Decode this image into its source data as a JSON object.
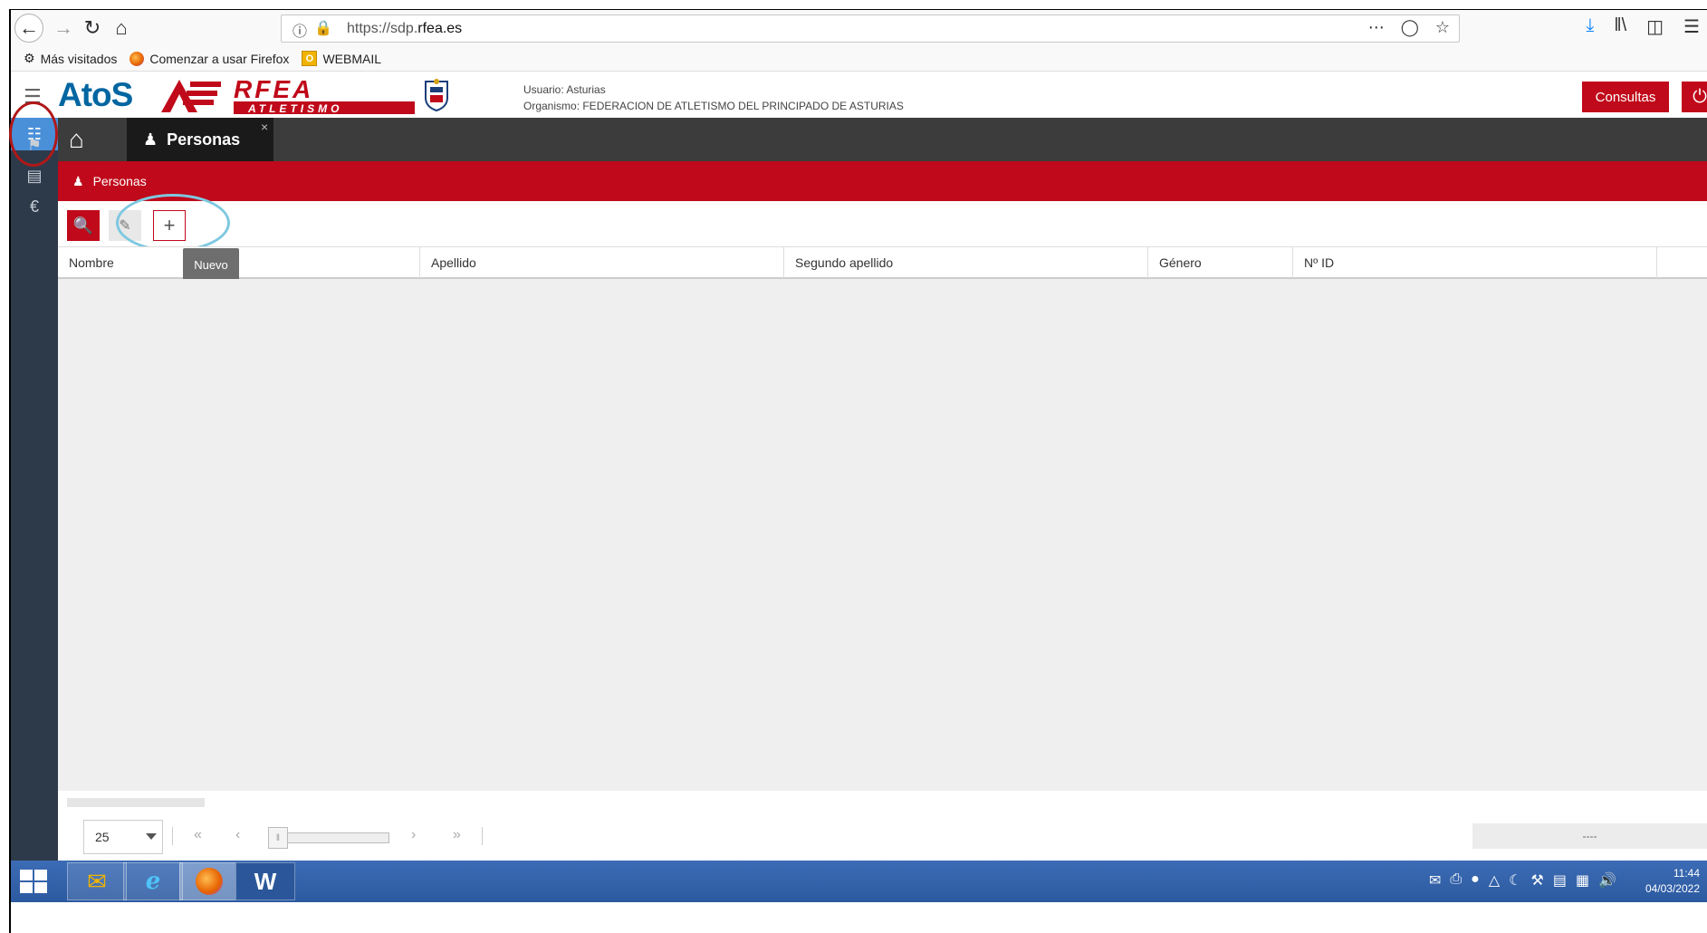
{
  "browser": {
    "url_prefix": "https://sdp.",
    "url_domain": "rfea.es",
    "bookmarks": [
      "Más visitados",
      "Comenzar a usar Firefox",
      "WEBMAIL"
    ],
    "bookmark_webmail_badge": "O"
  },
  "header": {
    "logo_left": "AtoS",
    "logo_rfea": "RFEA",
    "logo_rfea_sub": "ATLETISMO",
    "user_label": "Usuario: Asturias",
    "org_label": "Organismo: FEDERACION DE ATLETISMO DEL PRINCIPADO DE ASTURIAS",
    "consultas_label": "Consultas"
  },
  "sidebar": {
    "items": [
      {
        "icon": "sitemap-icon",
        "active": true
      },
      {
        "icon": "bookmark-icon",
        "active": false
      },
      {
        "icon": "card-icon",
        "active": false
      },
      {
        "icon": "euro-icon",
        "active": false
      }
    ]
  },
  "tabs": {
    "active_label": "Personas",
    "close_glyph": "×"
  },
  "breadcrumb": {
    "label": "Personas"
  },
  "actions": {
    "tooltip": "Nuevo"
  },
  "grid": {
    "columns": [
      "Nombre",
      "Apellido",
      "Segundo apellido",
      "Género",
      "Nº ID"
    ],
    "rows": []
  },
  "pager": {
    "page_size": "25",
    "info": "----"
  },
  "taskbar": {
    "apps": [
      "Outlook",
      "Internet Explorer",
      "Firefox",
      "Word"
    ],
    "active_app": "Firefox",
    "time": "11:44",
    "date": "04/03/2022"
  },
  "colors": {
    "brand_red": "#c0091a",
    "sidebar_bg": "#2d3a4a",
    "active_blue": "#4a90d9",
    "annotation_red": "#b01818",
    "annotation_blue": "#7ec8e0"
  }
}
